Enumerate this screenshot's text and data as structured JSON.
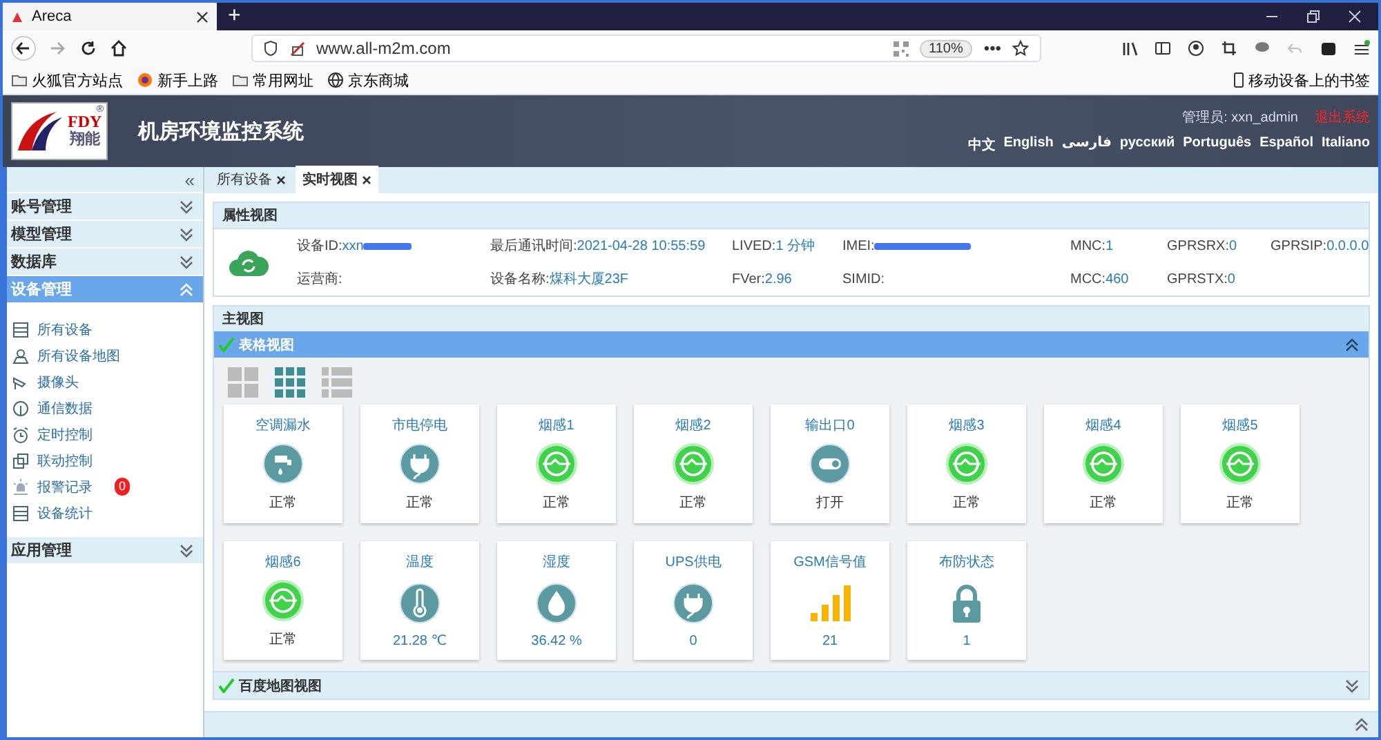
{
  "browser": {
    "tabs": [
      {
        "title": "Areca",
        "selected": true
      }
    ],
    "new_tab": "+",
    "url": "www.all-m2m.com",
    "zoom": "110%",
    "more": "•••",
    "bookmarks": [
      {
        "kind": "folder",
        "label": "火狐官方站点"
      },
      {
        "kind": "firefox",
        "label": "新手上路"
      },
      {
        "kind": "folder",
        "label": "常用网址"
      },
      {
        "kind": "globe",
        "label": "京东商城"
      }
    ],
    "mobile_bookmarks": "移动设备上的书签"
  },
  "header": {
    "logo_text": "FDY",
    "logo_sub": "翔能",
    "logo_mark": "®",
    "title": "机房环境监控系统",
    "user": "管理员: xxn_admin",
    "logout": "退出系统",
    "languages": [
      "中文",
      "English",
      "فارسی",
      "русский",
      "Português",
      "Español",
      "Italiano"
    ]
  },
  "sidebar": {
    "collapse": "«",
    "groups": [
      {
        "label": "账号管理",
        "selected": false,
        "expanded": false
      },
      {
        "label": "模型管理",
        "selected": false,
        "expanded": false
      },
      {
        "label": "数据库",
        "selected": false,
        "expanded": false
      },
      {
        "label": "设备管理",
        "selected": true,
        "expanded": true,
        "items": [
          {
            "kind": "list",
            "label": "所有设备"
          },
          {
            "kind": "map",
            "label": "所有设备地图"
          },
          {
            "kind": "camera",
            "label": "摄像头"
          },
          {
            "kind": "antenna",
            "label": "通信数据"
          },
          {
            "kind": "clock",
            "label": "定时控制"
          },
          {
            "kind": "link",
            "label": "联动控制"
          },
          {
            "kind": "alarm",
            "label": "报警记录",
            "badge": "0"
          },
          {
            "kind": "list",
            "label": "设备统计"
          }
        ]
      },
      {
        "label": "应用管理",
        "selected": false,
        "expanded": false
      }
    ]
  },
  "tabs": [
    {
      "label": "所有设备",
      "selected": false
    },
    {
      "label": "实时视图",
      "selected": true
    }
  ],
  "property_view": {
    "title": "属性视图",
    "fields": [
      {
        "label": "设备ID:",
        "value": "xxn"
      },
      {
        "label": "最后通讯时间: ",
        "value": "2021-04-28 10:55:59"
      },
      {
        "label": "LIVED: ",
        "value": "1 分钟"
      },
      {
        "label": "IMEI:"
      },
      {
        "label": "MNC:",
        "value": "1"
      },
      {
        "label": "GPRSRX:",
        "value": "0"
      },
      {
        "label": "GPRSIP:",
        "value": "0.0.0.0"
      },
      {
        "label": "运营商:"
      },
      {
        "label": "设备名称:",
        "value": "煤科大厦23F"
      },
      {
        "label": "FVer:",
        "value": "2.96"
      },
      {
        "label": "SIMID:"
      },
      {
        "label": "MCC:",
        "value": "460"
      },
      {
        "label": "GPRSTX:",
        "value": "0"
      }
    ]
  },
  "main_view": {
    "title": "主视图",
    "panels": [
      {
        "title": "表格视图",
        "expanded": true,
        "view_modes": [
          {
            "kind": "large",
            "selected": false
          },
          {
            "kind": "grid",
            "selected": true
          },
          {
            "kind": "list",
            "selected": false
          }
        ],
        "tiles": [
          {
            "name": "空调漏水",
            "kind": "faucet",
            "value": "正常",
            "numeric": false
          },
          {
            "name": "市电停电",
            "kind": "plug",
            "value": "正常",
            "numeric": false
          },
          {
            "name": "烟感1",
            "kind": "smoke",
            "value": "正常",
            "numeric": false
          },
          {
            "name": "烟感2",
            "kind": "smoke",
            "value": "正常",
            "numeric": false
          },
          {
            "name": "输出口0",
            "kind": "toggle",
            "value": "打开",
            "numeric": false
          },
          {
            "name": "烟感3",
            "kind": "smoke",
            "value": "正常",
            "numeric": false
          },
          {
            "name": "烟感4",
            "kind": "smoke",
            "value": "正常",
            "numeric": false
          },
          {
            "name": "烟感5",
            "kind": "smoke",
            "value": "正常",
            "numeric": false
          },
          {
            "name": "烟感6",
            "kind": "smoke",
            "value": "正常",
            "numeric": false
          },
          {
            "name": "温度",
            "kind": "thermometer",
            "value": "21.28 ℃",
            "numeric": true
          },
          {
            "name": "湿度",
            "kind": "drop",
            "value": "36.42 %",
            "numeric": true
          },
          {
            "name": "UPS供电",
            "kind": "plug",
            "value": "0",
            "numeric": true
          },
          {
            "name": "GSM信号值",
            "kind": "signal",
            "value": "21",
            "numeric": true
          },
          {
            "name": "布防状态",
            "kind": "lock",
            "value": "1",
            "numeric": true
          }
        ]
      },
      {
        "title": "百度地图视图",
        "expanded": false
      }
    ]
  }
}
